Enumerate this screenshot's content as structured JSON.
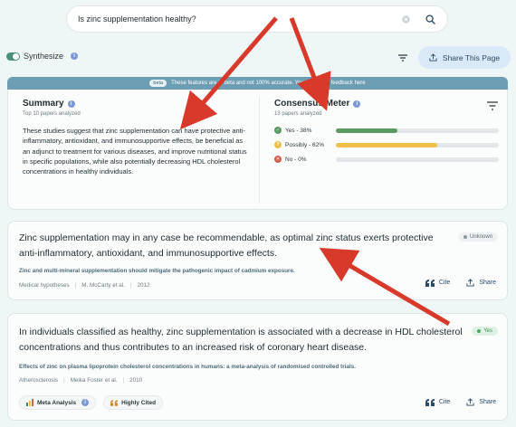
{
  "search": {
    "query": "Is zinc supplementation healthy?"
  },
  "synthesize": {
    "label": "Synthesize",
    "enabled": true
  },
  "header": {
    "share_label": "Share This Page"
  },
  "beta": {
    "badge": "beta",
    "text": "These features are in beta and not 100% accurate. You can share feedback here"
  },
  "summary": {
    "title": "Summary",
    "subtitle": "Top 10 papers analyzed",
    "body": "These studies suggest that zinc supplementation can have protective anti-inflammatory, antioxidant, and immunosupportive effects, be beneficial as an adjunct to treatment for various diseases, and improve nutritional status in specific populations, while also potentially decreasing HDL cholesterol concentrations in healthy individuals."
  },
  "consensus": {
    "title": "Consensus Meter",
    "subtitle": "13 papers analyzed",
    "rows": [
      {
        "label": "Yes - 38%",
        "value": 0.38,
        "color": "#5a9a62"
      },
      {
        "label": "Possibly - 62%",
        "value": 0.62,
        "color": "#efbf4a"
      },
      {
        "label": "No - 0%",
        "value": 0.0,
        "color": "#d2614f"
      }
    ]
  },
  "papers": [
    {
      "claim": "Zinc supplementation may in any case be recommendable, as optimal zinc status exerts protective anti-inflammatory, antioxidant, and immunosupportive effects.",
      "title": "Zinc and multi-mineral supplementation should mitigate the pathogenic impact of cadmium exposure.",
      "journal": "Medical hypotheses",
      "authors": "M. McCarty et al.",
      "year": "2012",
      "tag": "Unknown",
      "cite": "Cite",
      "share": "Share"
    },
    {
      "claim": "In individuals classified as healthy, zinc supplementation is associated with a decrease in HDL cholesterol concentrations and thus contributes to an increased risk of coronary heart disease.",
      "title": "Effects of zinc on plasma lipoprotein cholesterol concentrations in humans: a meta-analysis of randomised controlled trials.",
      "journal": "Atherosclerosis",
      "authors": "Meika Foster et al.",
      "year": "2010",
      "tag": "Yes",
      "badge1": "Meta Analysis",
      "badge2": "Highly Cited",
      "cite": "Cite",
      "share": "Share"
    }
  ],
  "colors": {
    "arrow": "#d8392b",
    "accent": "#4b8f7d"
  }
}
